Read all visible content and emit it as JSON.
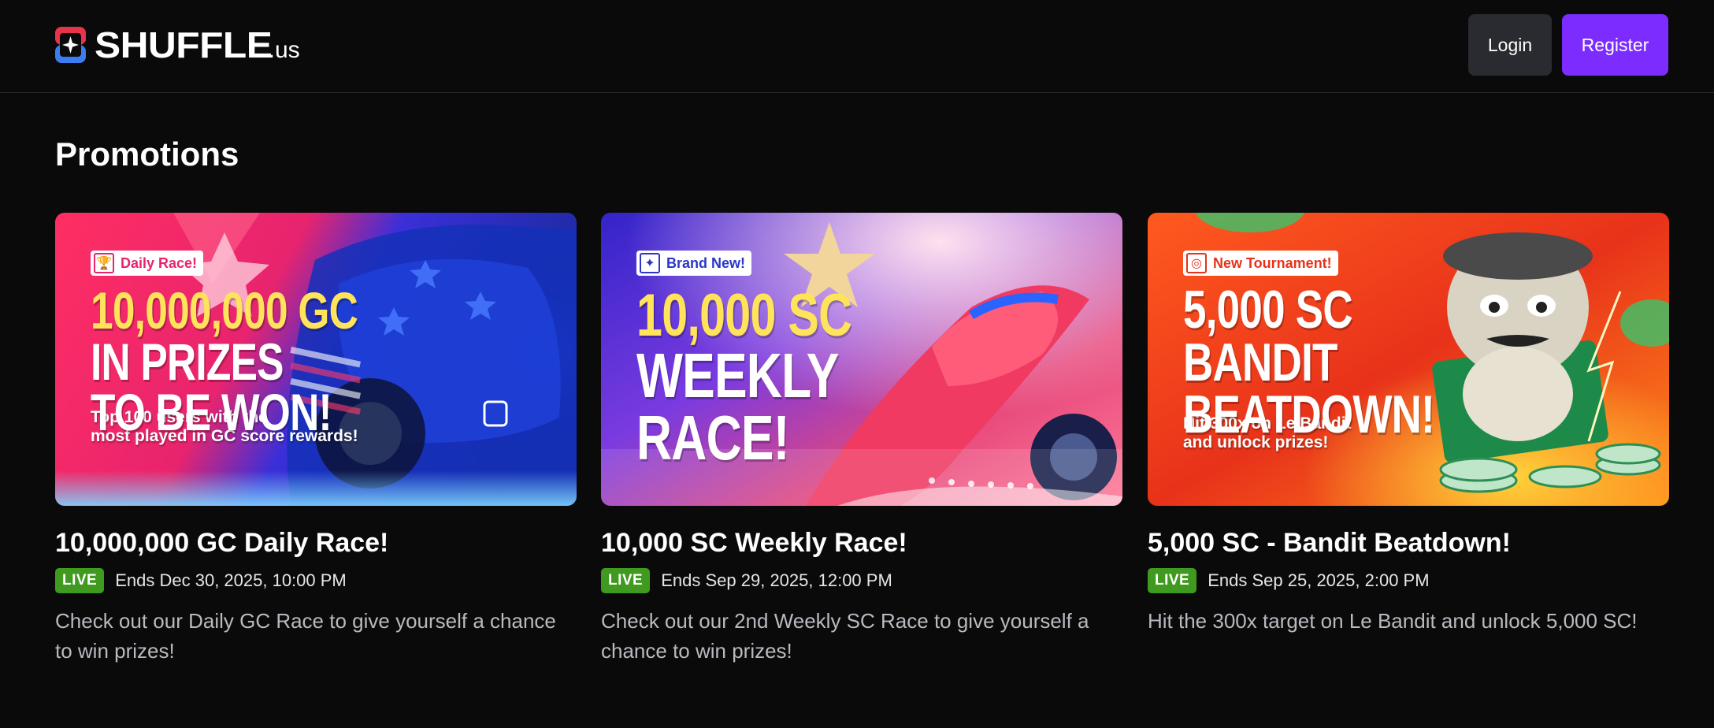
{
  "header": {
    "logo_word": "SHUFFLE",
    "logo_tld": ".us",
    "login_label": "Login",
    "register_label": "Register"
  },
  "page": {
    "title": "Promotions"
  },
  "colors": {
    "accent": "#7c2cff",
    "live_badge": "#3f9a1f",
    "headline_yellow": "#ffe35a"
  },
  "promotions": [
    {
      "tag": "Daily Race!",
      "tag_icon": "trophy-icon",
      "banner_line1": "10,000,000 GC",
      "banner_line2": "IN PRIZES",
      "banner_line3": "TO BE WON!",
      "banner_sub1": "Top 100 users with the",
      "banner_sub2": "most played in GC score rewards!",
      "title": "10,000,000 GC Daily Race!",
      "status": "LIVE",
      "ends": "Ends Dec 30, 2025, 10:00 PM",
      "description": "Check out our Daily GC Race to give yourself a chance to win prizes!"
    },
    {
      "tag": "Brand New!",
      "tag_icon": "sparkle-icon",
      "banner_line1": "10,000 SC",
      "banner_line2": "WEEKLY",
      "banner_line3": "RACE!",
      "title": "10,000 SC Weekly Race!",
      "status": "LIVE",
      "ends": "Ends Sep 29, 2025, 12:00 PM",
      "description": "Check out our 2nd Weekly SC Race to give yourself a chance to win prizes!"
    },
    {
      "tag": "New Tournament!",
      "tag_icon": "target-icon",
      "banner_line1": "5,000 SC",
      "banner_line2": "BANDIT",
      "banner_line3": "BEATDOWN!",
      "banner_sub1": "Hit 300x on Le Bandit",
      "banner_sub2": "and unlock prizes!",
      "title": "5,000 SC - Bandit Beatdown!",
      "status": "LIVE",
      "ends": "Ends Sep 25, 2025, 2:00 PM",
      "description": "Hit the 300x target on Le Bandit and unlock 5,000 SC!"
    }
  ]
}
